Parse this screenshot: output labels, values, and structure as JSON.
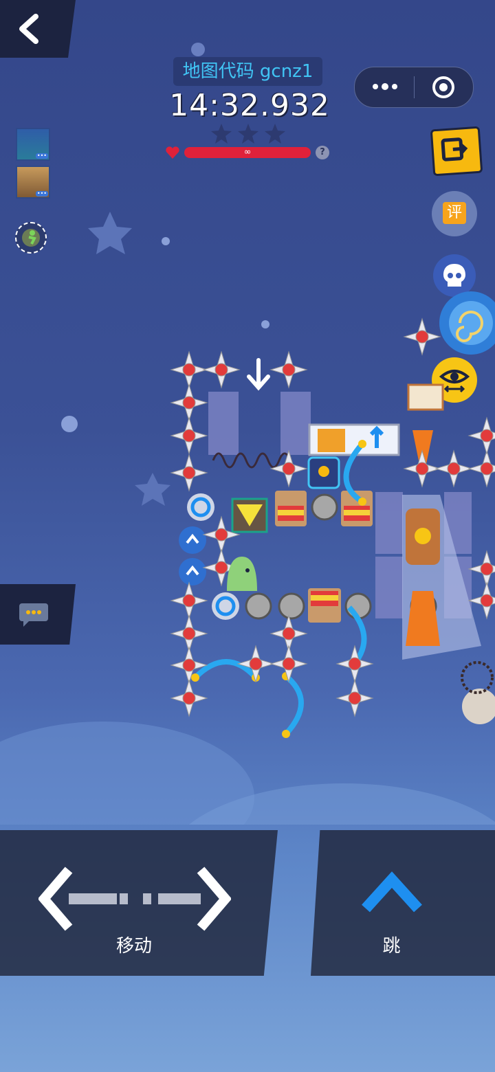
{
  "hud": {
    "map_code_label": "地图代码 gcnz1",
    "timer": "14:32.932",
    "stars_earned": 0,
    "stars_total": 3,
    "lives": "∞",
    "help_icon": "?"
  },
  "buttons": {
    "move_label": "移动",
    "jump_label": "跳",
    "rate_label": "评"
  },
  "colors": {
    "background_top": "#34478a",
    "accent_cyan": "#41c5f5",
    "health_red": "#e0213a",
    "jump_blue": "#1e8ff0",
    "reward_yellow": "#f7b90f"
  },
  "icons": [
    "back-chevron-icon",
    "more-dots-icon",
    "record-target-icon",
    "exit-level-icon",
    "skull-icon",
    "eye-pan-icon",
    "chat-bubble-icon",
    "heart-icon",
    "star-icon"
  ]
}
